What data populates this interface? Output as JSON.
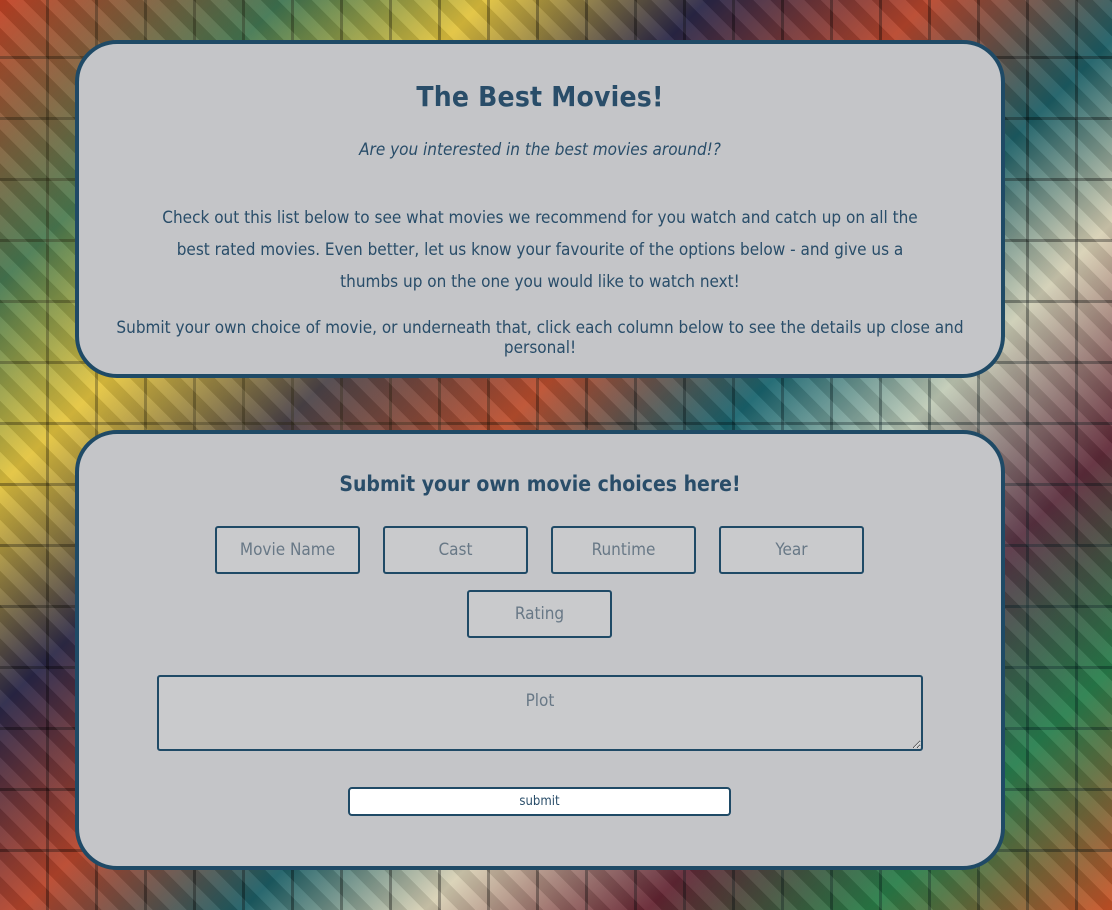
{
  "intro": {
    "title": "The Best Movies!",
    "tagline": "Are you interested in the best movies around!?",
    "body": "Check out this list below to see what movies we recommend for you watch and catch up on all the best rated movies. Even better, let us know your favourite of the options below - and give us a thumbs up on the one you would like to watch next!",
    "submit_note": "Submit your own choice of movie, or underneath that, click each column below to see the details up close and personal!"
  },
  "form": {
    "heading": "Submit your own movie choices here!",
    "fields": {
      "movie_name": "Movie Name",
      "cast": "Cast",
      "runtime": "Runtime",
      "year": "Year",
      "rating": "Rating",
      "plot": "Plot"
    },
    "submit_label": "submit"
  }
}
